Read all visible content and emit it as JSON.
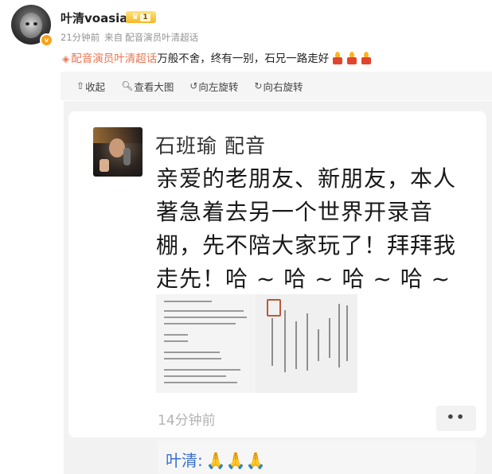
{
  "header": {
    "username": "叶清voasia",
    "rank_level": "1",
    "time": "21分钟前",
    "source_label": "来自",
    "source": "配音演员叶清超话"
  },
  "post": {
    "tag": "配音演员叶清超话",
    "text": "万般不舍，终有一别，石兄一路走好",
    "candle_count": 3
  },
  "toolbar": {
    "collapse": "收起",
    "view_large": "查看大图",
    "rotate_left": "向左旋转",
    "rotate_right": "向右旋转"
  },
  "image": {
    "author": "石班瑜 配音",
    "message": "亲爱的老朋友、新朋友，本人著急着去另一个世界开录音棚，先不陪大家玩了！拜拜我走先！哈 ~ 哈 ~ 哈 ~ 哈 ~",
    "time": "14分钟前",
    "reply_name": "叶清:",
    "reply_emoji": "🙏🙏🙏",
    "more": "••"
  },
  "icons": {
    "collapse": "arrow-up-icon",
    "view_large": "magnify-icon",
    "rotate_left": "rotate-left-icon",
    "rotate_right": "rotate-right-icon",
    "tag": "supertopic-icon"
  },
  "colors": {
    "tag": "#eb7350",
    "candle": "#e2452e",
    "flame": "#ffb21c",
    "badge": "#f7a21a"
  }
}
